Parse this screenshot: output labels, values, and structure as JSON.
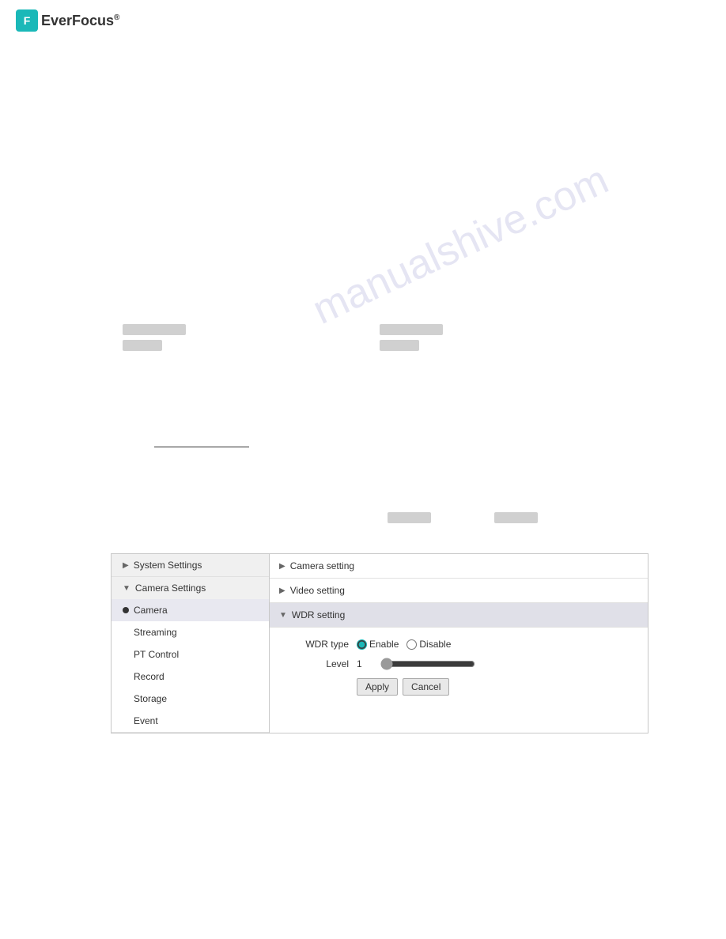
{
  "brand": {
    "icon_letter": "F",
    "name": "EverFocus",
    "registered": "®"
  },
  "watermark": "manualshive.com",
  "sidebar": {
    "system_settings": {
      "label": "System Settings",
      "arrow": "▶"
    },
    "camera_settings": {
      "label": "Camera Settings",
      "arrow": "▼"
    },
    "sub_items": [
      {
        "label": "Camera",
        "active": true,
        "bullet": true
      },
      {
        "label": "Streaming",
        "active": false,
        "bullet": false
      },
      {
        "label": "PT Control",
        "active": false,
        "bullet": false
      },
      {
        "label": "Record",
        "active": false,
        "bullet": false
      },
      {
        "label": "Storage",
        "active": false,
        "bullet": false
      },
      {
        "label": "Event",
        "active": false,
        "bullet": false
      }
    ]
  },
  "content": {
    "sections": [
      {
        "label": "Camera setting",
        "arrow": "▶",
        "expanded": false
      },
      {
        "label": "Video setting",
        "arrow": "▶",
        "expanded": false
      },
      {
        "label": "WDR setting",
        "arrow": "▼",
        "expanded": true
      }
    ],
    "wdr": {
      "wdr_type_label": "WDR type",
      "enable_label": "Enable",
      "disable_label": "Disable",
      "level_label": "Level",
      "level_value": "1",
      "apply_label": "Apply",
      "cancel_label": "Cancel"
    }
  }
}
